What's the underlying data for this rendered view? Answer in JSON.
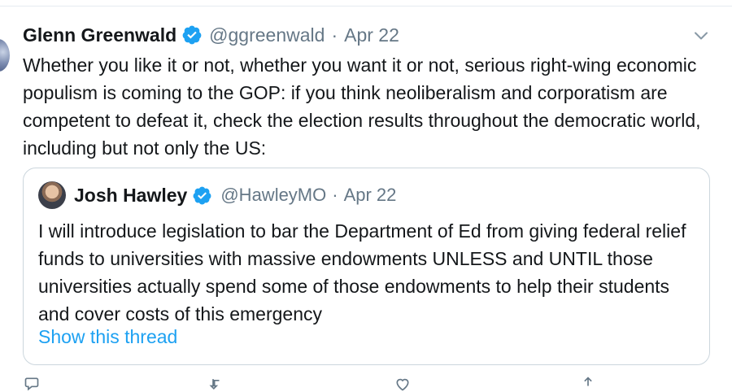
{
  "tweet": {
    "author_name": "Glenn Greenwald",
    "handle": "@ggreenwald",
    "separator": "·",
    "date": "Apr 22",
    "text": "Whether you like it or not, whether you want it or not, serious right-wing economic populism is coming to the GOP: if you think neoliberalism and corporatism are competent to defeat it, check the election results throughout the democratic world, including but not only the US:"
  },
  "quoted_tweet": {
    "author_name": "Josh Hawley",
    "handle": "@HawleyMO",
    "separator": "·",
    "date": "Apr 22",
    "text": "I will introduce legislation to bar the Department of Ed from giving federal relief funds to universities with massive endowments UNLESS and UNTIL those universities actually spend some of those endowments to help their students and cover costs of this emergency",
    "show_thread_label": "Show this thread"
  },
  "icons": {
    "verified": "verified-badge-icon",
    "menu": "chevron-down-icon",
    "reply": "reply-icon",
    "retweet": "retweet-icon",
    "like": "like-icon",
    "share": "share-icon"
  },
  "colors": {
    "verified_blue": "#1da1f2",
    "link_blue": "#1da1f2",
    "secondary_text": "#657786",
    "border": "#ccd6dd"
  }
}
